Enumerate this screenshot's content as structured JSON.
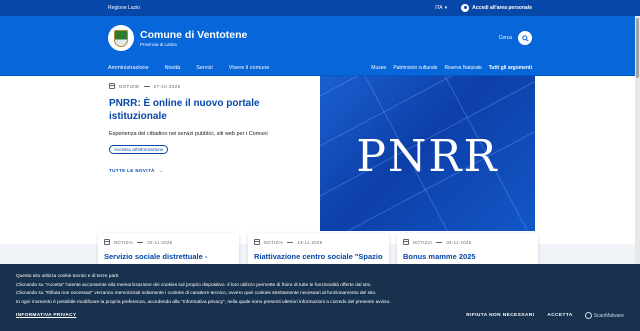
{
  "slim_header": {
    "region": "Regione Lazio",
    "lang": "ITA",
    "login": "Accedi all'area personale"
  },
  "brand": {
    "title": "Comune di Ventotene",
    "subtitle": "Provincia di Latina"
  },
  "search": {
    "label": "Cerca"
  },
  "nav": {
    "main": [
      "Amministrazione",
      "Novità",
      "Servizi",
      "Vivere il comune"
    ],
    "secondary": [
      "Museo",
      "Patrimonio culturale",
      "Riserva Naturale",
      "Tutti gli argomenti"
    ]
  },
  "hero": {
    "category": "NOTIZIE",
    "date": "27-10-2025",
    "title": "PNRR: È online il nuovo portale istituzionale",
    "description": "Esperienza del cittadino nei servizi pubblici, siti web per i Comuni",
    "tag": "Accesso all'informazione",
    "all_news": "TUTTE LE NOVITÀ",
    "image_text": "PNRR"
  },
  "cards": [
    {
      "category": "NOTIZIA",
      "date": "20-11-2025",
      "title": "Servizio sociale distrettuale -"
    },
    {
      "category": "NOTIZIA",
      "date": "13-11-2025",
      "title": "Riattivazione centro sociale \"Spazio"
    },
    {
      "category": "NOTIZIA",
      "date": "03-11-2025",
      "title": "Bonus mamme 2025"
    }
  ],
  "cookie": {
    "lines": [
      "Questo sito utilizza cookie tecnici e di terze parti.",
      "Cliccando su \"Accetta\" l'utente acconsente alla memorizzazione dei cookies sul proprio dispositivo. Il loro utilizzo permette di fruire di tutte le funzionalità offerte dal sito.",
      "Cliccando su \"Rifiuta non necessari\" verranno memorizzati solamente i cookies di carattere tecnico, ovvero quei cookies strettamente necessari al funzionamento del sito.",
      "In ogni momento è possibile modificare la propria preferenza, accedendo alla \"Informativa privacy\", nella quale sono presenti ulteriori informazioni a corredo del presente avviso."
    ],
    "policy": "INFORMATIVA PRIVACY",
    "reject": "RIFIUTA NON NECESSARI",
    "accept": "ACCETTA",
    "badge": "ScanMalware"
  },
  "colors": {
    "primary": "#0766d9",
    "dark": "#0747a8",
    "cookie_bg": "#18324d"
  }
}
